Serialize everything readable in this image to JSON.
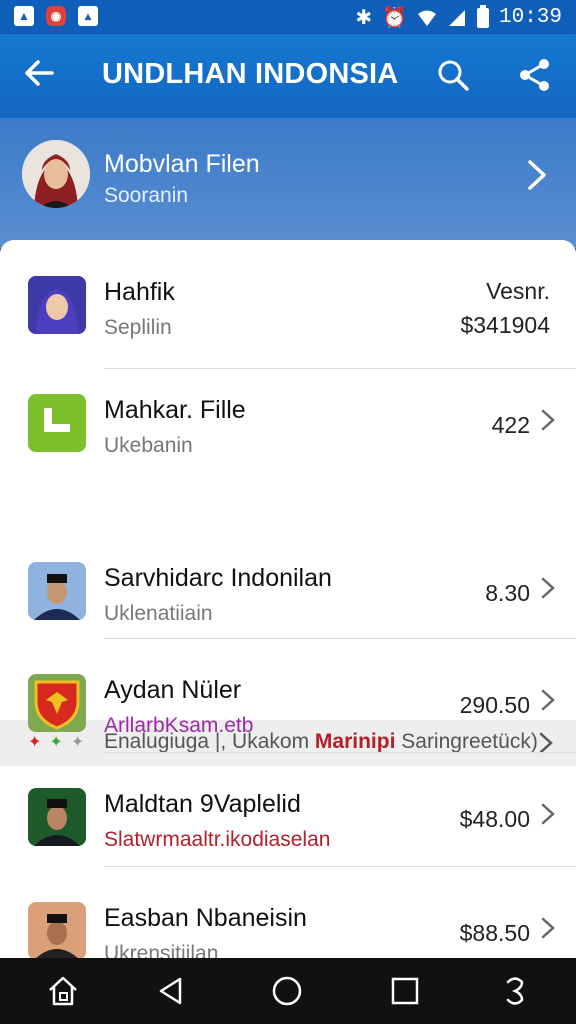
{
  "status_bar": {
    "time": "10:39"
  },
  "app_bar": {
    "title": "UNDLHAN INDONSIA"
  },
  "profile": {
    "name": "Mobvlan Filen",
    "subtitle": "Sooranin"
  },
  "rows_top": [
    {
      "title": "Hahfik",
      "subtitle": "Seplilin",
      "value_label": "Vesnr.",
      "value": "$341904"
    },
    {
      "title": "Mahkar. Fille",
      "subtitle": "Ukebanin",
      "value": "422"
    }
  ],
  "banner": {
    "text_before": "Enalugiuga |, Ukakom ",
    "text_bold": "Marinipi",
    "text_after": " Saringreetück)"
  },
  "rows_bottom": [
    {
      "title": "Sarvhidarc Indonilan",
      "subtitle": "Uklenatiiain",
      "subtitle_color": "#7a7a7a",
      "value": "8.30"
    },
    {
      "title": "Aydan Nüler",
      "subtitle": "ArllarbKsam.etb",
      "subtitle_color": "#9b2aa8",
      "value": "290.50"
    },
    {
      "title": "Maldtan 9Vaplelid",
      "subtitle": "Slatwrmaaltr.ikodiaselan",
      "subtitle_color": "#b3202a",
      "value": "$48.00"
    },
    {
      "title": "Easban Nbaneisin",
      "subtitle": "Ukrensitiilan",
      "subtitle_color": "#7a7a7a",
      "value": "$88.50"
    }
  ],
  "colors": {
    "primary": "#1267c0",
    "accent_red": "#b3202a",
    "nav_bg": "#111111"
  }
}
